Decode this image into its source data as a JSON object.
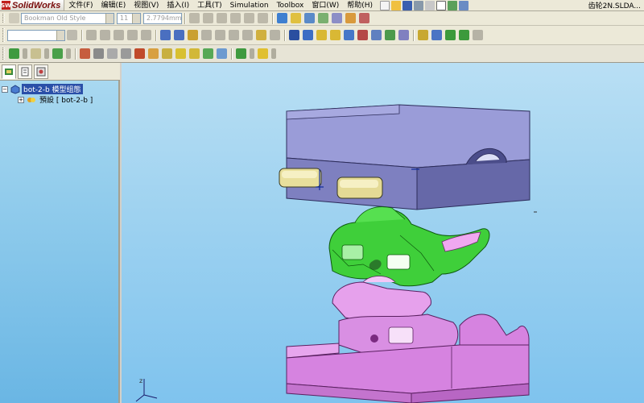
{
  "app": {
    "name": "SolidWorks",
    "logo_badge": "SW",
    "document_title": "齿轮2N.SLDA..."
  },
  "menu": {
    "items": [
      "文件(F)",
      "编辑(E)",
      "视图(V)",
      "插入(I)",
      "工具(T)",
      "Simulation",
      "Toolbox",
      "窗口(W)",
      "帮助(H)"
    ]
  },
  "format_toolbar": {
    "font_combo_value": "Bookman Old Style",
    "size_combo_value": "11",
    "unit_combo_value": "2.7794mm"
  },
  "toolbar2": {
    "layer_combo_value": ""
  },
  "feature_tree": {
    "tabs": [
      "feature-manager",
      "property-manager",
      "configuration-manager"
    ],
    "root_label": "bot-2-b 模型组態",
    "child_label": "預設 [ bot-2-b ]"
  },
  "viewport": {
    "axis_label": "z",
    "background_top": "#b9dff4",
    "background_bottom": "#7fc3ee"
  },
  "colors": {
    "top_block": "#7e80c0",
    "top_block_side": "#6466a8",
    "green_part": "#3fcf3a",
    "pink_part": "#df8ee6",
    "pink_block": "#d683e0",
    "insert_part": "#e8df9c"
  }
}
